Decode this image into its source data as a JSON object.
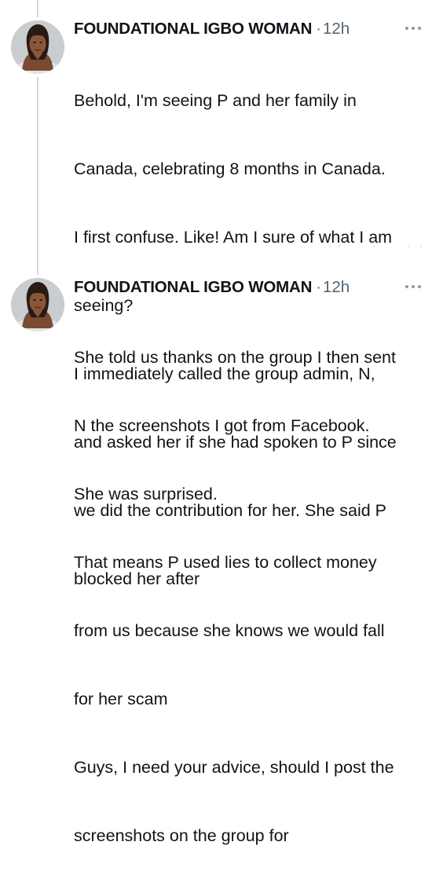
{
  "tweets": [
    {
      "author": "FOUNDATIONAL IGBO WOMAN",
      "separator": "·",
      "time": "12h",
      "lines": [
        "Behold, I'm seeing P and her family in",
        "Canada, celebrating 8 months in Canada.",
        "I first confuse. Like! Am I sure of what I am",
        "seeing?",
        "I immediately called the group admin, N,",
        "and asked her if she had spoken to P since",
        "we did the contribution for her. She said P",
        "blocked her after"
      ],
      "more_icon": "more-horizontal-icon"
    },
    {
      "author": "FOUNDATIONAL IGBO WOMAN",
      "separator": "·",
      "time": "12h",
      "lines": [
        "She told us thanks on the group I then sent",
        "N the screenshots I got from Facebook.",
        "She was surprised.",
        "That means P used lies to collect money",
        "from us because she knows we would fall",
        "for her scam",
        "Guys, I need your advice, should I post the",
        "screenshots on the group for"
      ],
      "more_icon": "more-horizontal-icon"
    }
  ],
  "colors": {
    "text": "#0f1419",
    "secondary": "#536471",
    "thread_line": "#cfd9de"
  }
}
